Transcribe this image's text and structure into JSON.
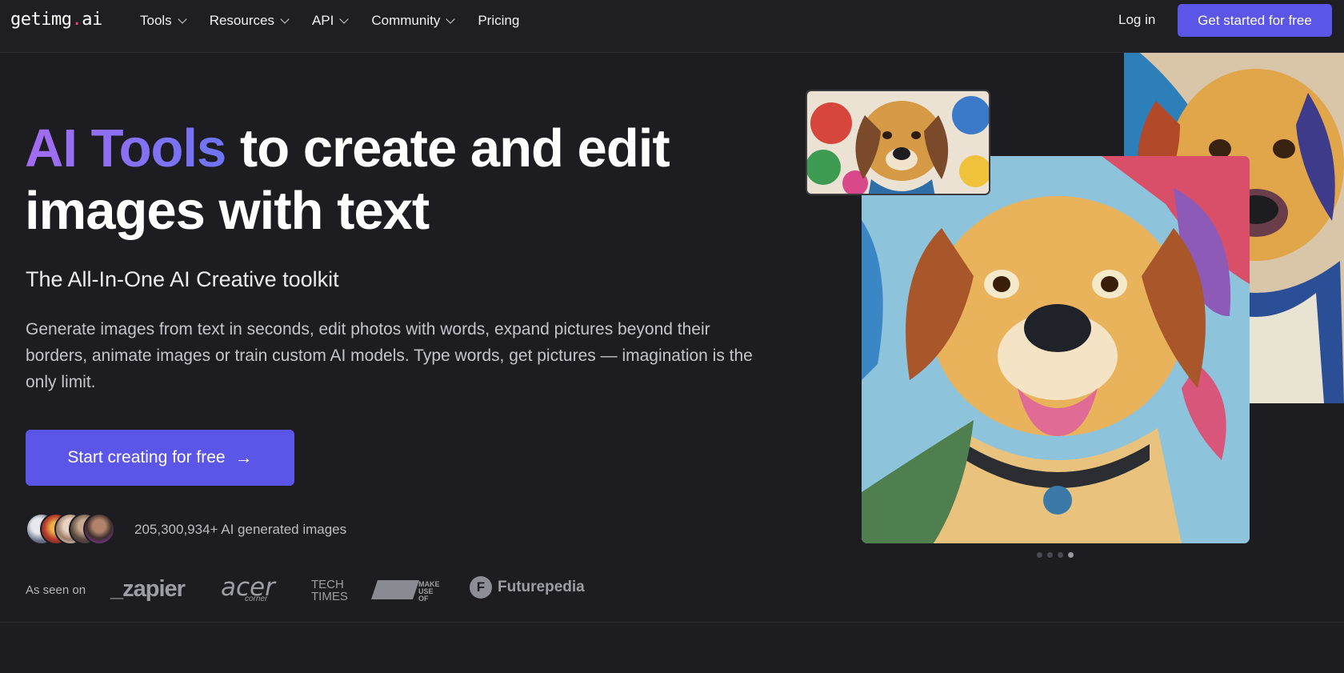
{
  "header": {
    "logo_prefix": "getimg",
    "logo_dot": ".",
    "logo_suffix": "ai",
    "nav": [
      {
        "label": "Tools",
        "dropdown": true
      },
      {
        "label": "Resources",
        "dropdown": true
      },
      {
        "label": "API",
        "dropdown": true
      },
      {
        "label": "Community",
        "dropdown": true
      },
      {
        "label": "Pricing",
        "dropdown": false
      }
    ],
    "login_label": "Log in",
    "cta_label": "Get started for free"
  },
  "hero": {
    "title_highlight": "AI Tools",
    "title_rest": " to create and edit images with text",
    "subtitle": "The All-In-One AI Creative toolkit",
    "description": "Generate images from text in seconds, edit photos with words, expand pictures beyond their borders, animate images or train custom AI models. Type words, get pictures — imagination is the only limit.",
    "start_label": "Start creating for free",
    "start_arrow": "→",
    "image_count": "205,300,934+ AI generated images",
    "seen_on": "As seen on",
    "brands": {
      "zapier": "_zapier",
      "acer": "acer",
      "acer_sub": "corner",
      "tech_top": "TECH",
      "tech_bottom": "TIMES",
      "muo": "MAKE USE OF",
      "futurepedia_icon": "F",
      "futurepedia": "Futurepedia"
    }
  },
  "carousel": {
    "slides": 4,
    "active": 4
  },
  "colors": {
    "background": "#1d1d21",
    "accent": "#5b55e8",
    "gradient_start": "#a46cf2",
    "gradient_end": "#6d74f4",
    "logo_dot": "#ef4470"
  },
  "icons": [
    "chevron-down-icon",
    "arrow-right-icon",
    "futurepedia-logo-icon"
  ]
}
